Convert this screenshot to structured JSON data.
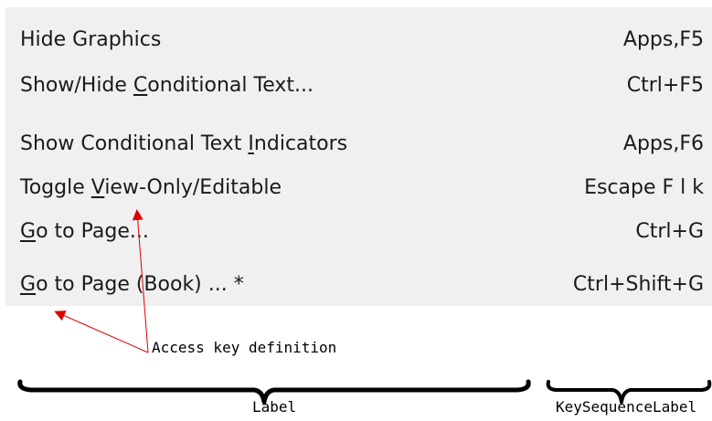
{
  "menu": {
    "items": [
      {
        "pre": "Hide Graphics",
        "acc": "",
        "post": "",
        "keys": "Apps,F5"
      },
      {
        "pre": "Show/Hide ",
        "acc": "C",
        "post": "onditional Text...",
        "keys": "Ctrl+F5"
      },
      {
        "pre": "Show Conditional Text ",
        "acc": "I",
        "post": "ndicators",
        "keys": "Apps,F6"
      },
      {
        "pre": "Toggle ",
        "acc": "V",
        "post": "iew-Only/Editable",
        "keys": "Escape F l k"
      },
      {
        "pre": "",
        "acc": "G",
        "post": "o to Page...",
        "keys": "Ctrl+G"
      },
      {
        "pre": "",
        "acc": "G",
        "post": "o to Page (Book) ... *",
        "keys": "Ctrl+Shift+G"
      }
    ]
  },
  "annotations": {
    "access_key": "Access key definition",
    "label": "Label",
    "key_sequence_label": "KeySequenceLabel",
    "arrow_color": "#e00000"
  }
}
